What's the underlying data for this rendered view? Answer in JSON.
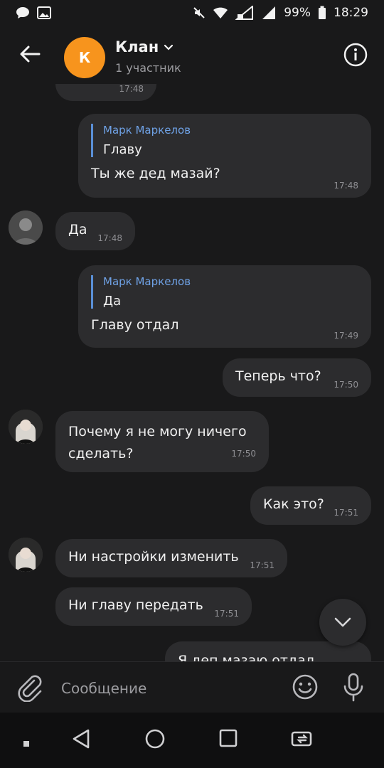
{
  "status_bar": {
    "battery": "99%",
    "time": "18:29"
  },
  "header": {
    "avatar_letter": "К",
    "title": "Клан",
    "subtitle": "1 участник",
    "avatar_color": "#f7941d"
  },
  "messages": [
    {
      "type": "incoming",
      "text": "",
      "time": "17:48",
      "partial": true
    },
    {
      "type": "outgoing",
      "reply_name": "Марк Маркелов",
      "reply_text": "Главу",
      "text": "Ты же дед мазай?",
      "time": "17:48"
    },
    {
      "type": "incoming",
      "text": "Да",
      "time": "17:48",
      "avatar": "avatar-gray"
    },
    {
      "type": "outgoing",
      "reply_name": "Марк Маркелов",
      "reply_text": "Да",
      "text": "Главу отдал",
      "time": "17:49"
    },
    {
      "type": "outgoing",
      "text": "Теперь что?",
      "time": "17:50"
    },
    {
      "type": "incoming",
      "text": "Почему я не могу ничего сделать?",
      "time": "17:50",
      "avatar": "avatar-woman"
    },
    {
      "type": "outgoing",
      "text": "Как это?",
      "time": "17:51"
    },
    {
      "type": "incoming",
      "text": "Ни настройки изменить",
      "time": "17:51",
      "avatar": "avatar-woman"
    },
    {
      "type": "incoming",
      "text": "Ни главу передать",
      "time": "17:51"
    },
    {
      "type": "outgoing",
      "text": "Я деп мазаю отдал",
      "time": "",
      "partial": true
    }
  ],
  "composer": {
    "placeholder": "Сообщение"
  },
  "colors": {
    "background": "#19191a",
    "bubble": "#2c2c2e",
    "reply_accent": "#5a8fd6"
  }
}
